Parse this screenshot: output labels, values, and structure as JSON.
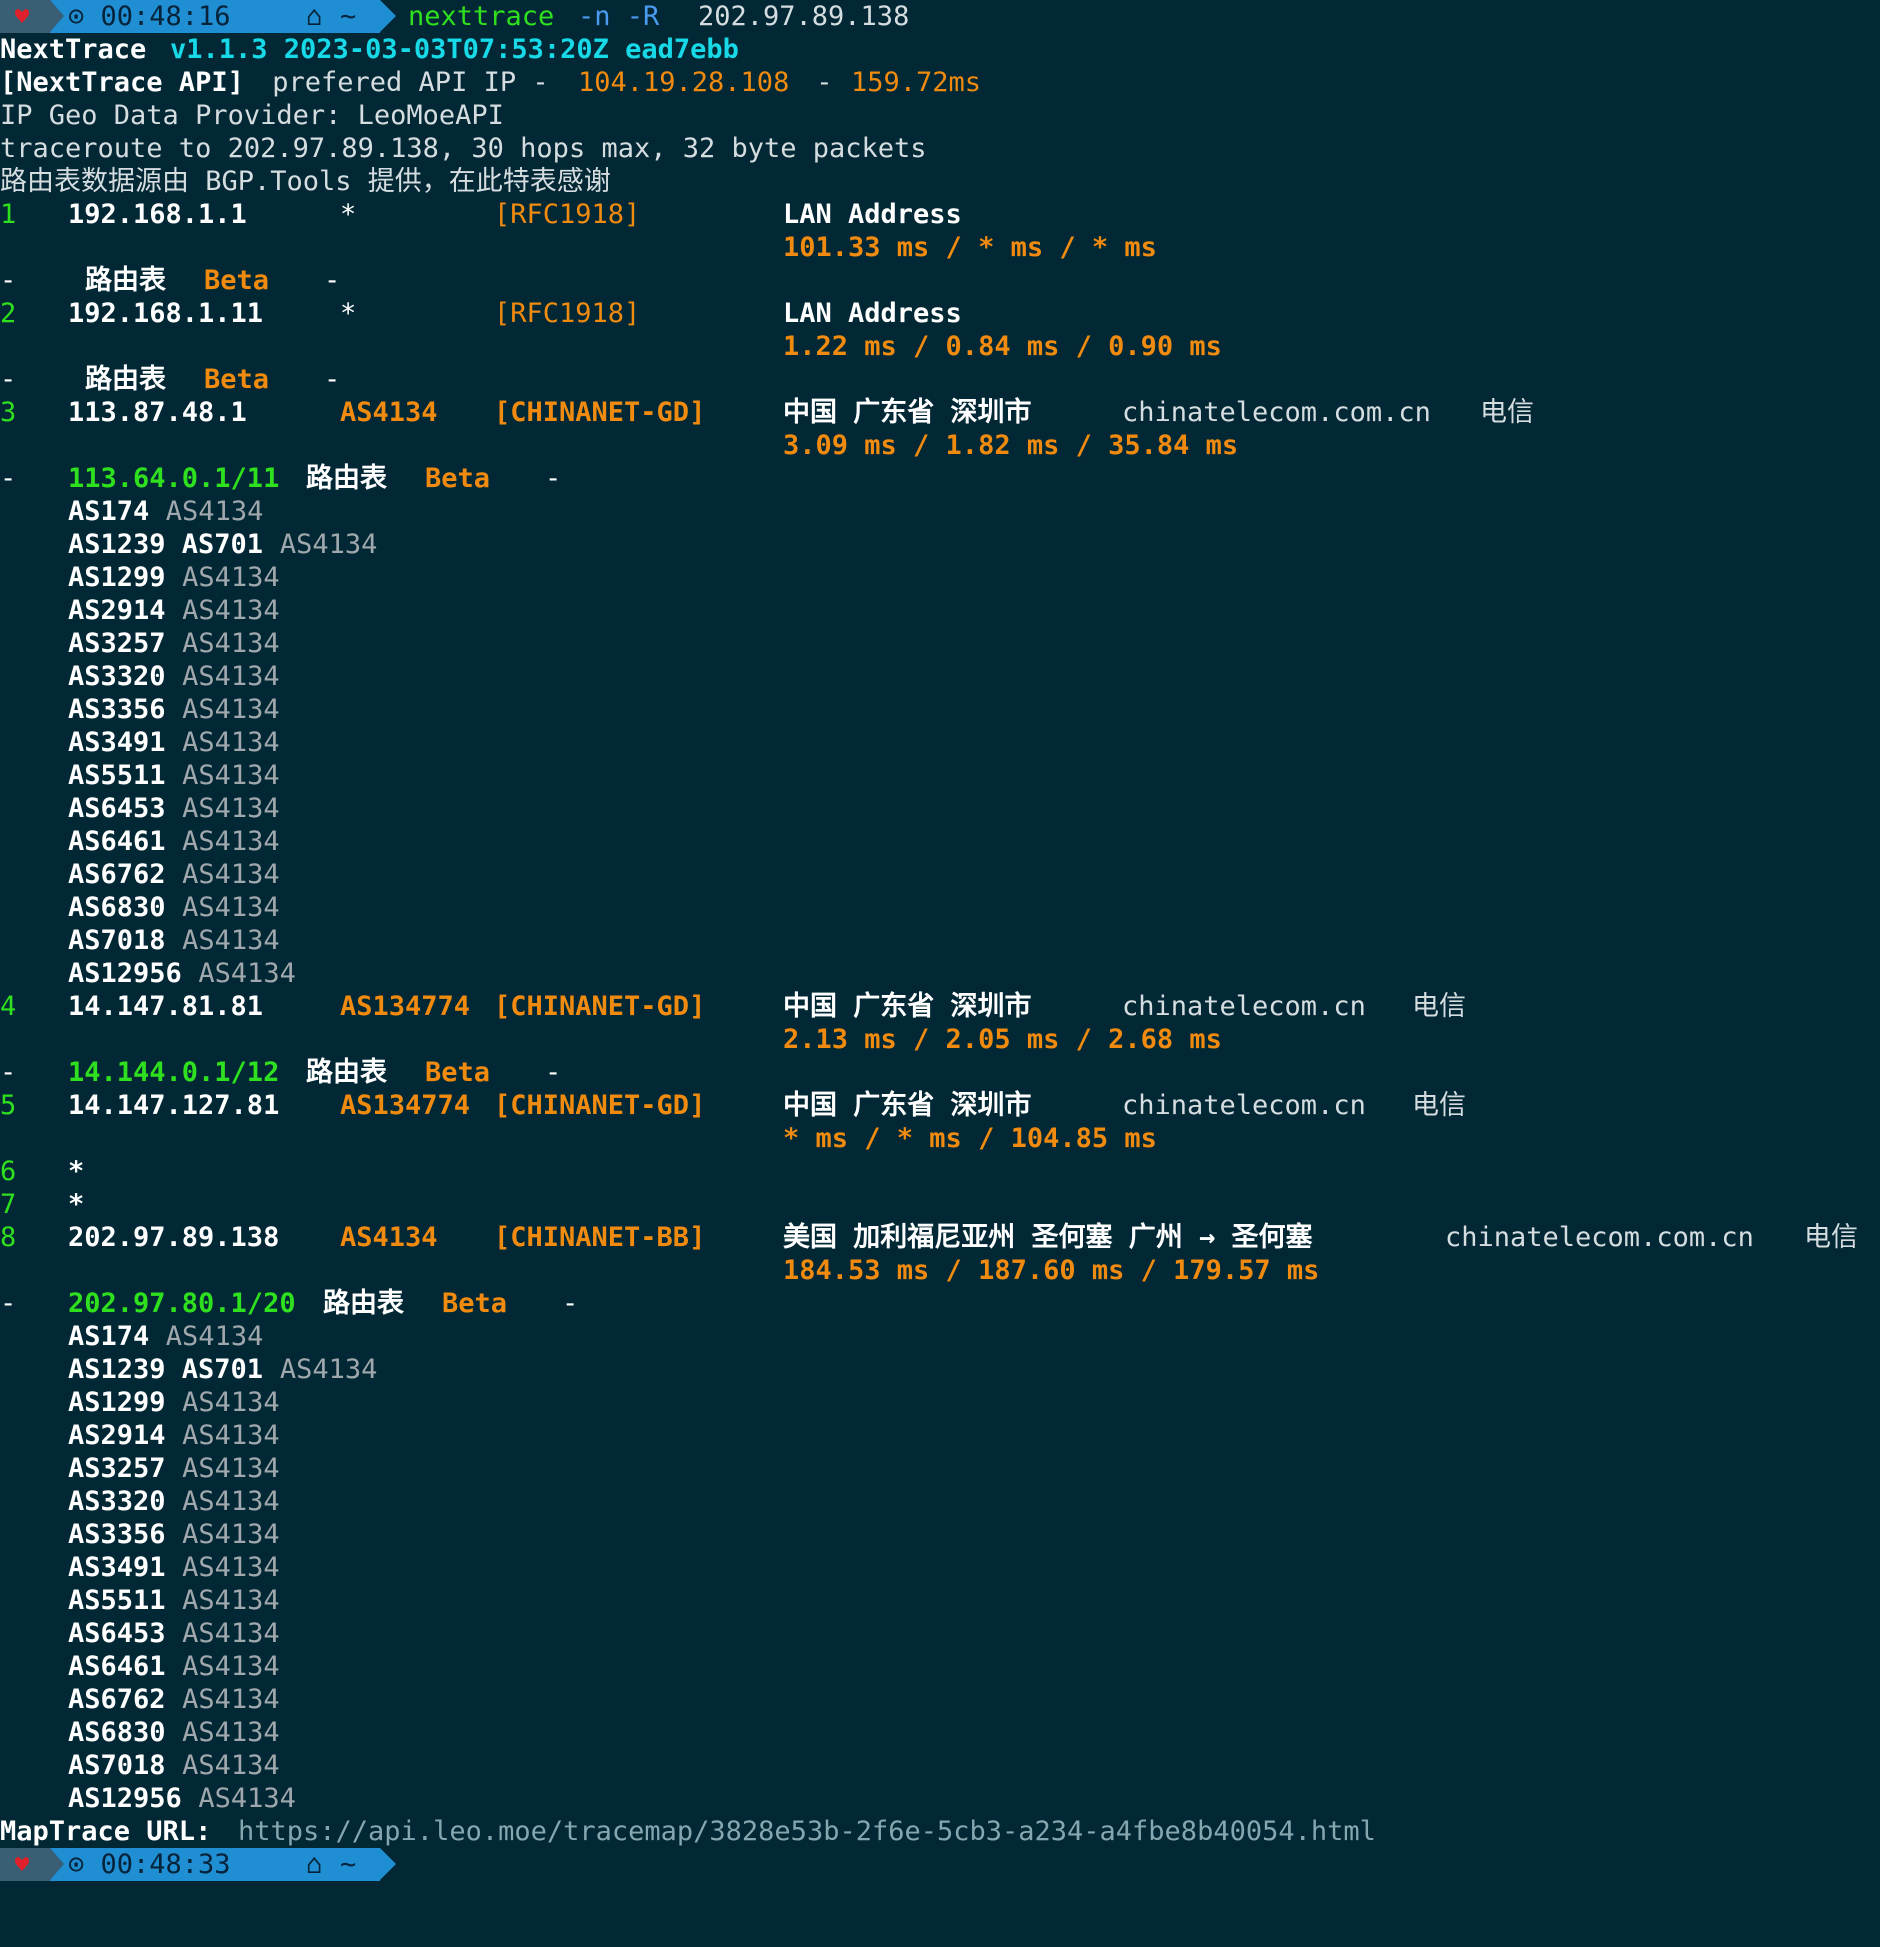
{
  "prompt_top": {
    "time": "⊙ 00:48:16",
    "home": "~",
    "cmd": "nexttrace",
    "flags": "-n -R",
    "target": "202.97.89.138"
  },
  "header": {
    "l1_a": "NextTrace ",
    "l1_b": "v1.1.3 2023-03-03T07:53:20Z ead7ebb",
    "l2_a": "[NextTrace API]",
    "l2_b": " prefered API IP - ",
    "l2_c": "104.19.28.108",
    "l2_d": " - ",
    "l2_e": "159.72ms",
    "l3": "IP Geo Data Provider: LeoMoeAPI",
    "l4": "traceroute to 202.97.89.138, 30 hops max, 32 byte packets",
    "l5": "路由表数据源由 BGP.Tools 提供，在此特表感谢"
  },
  "hops": {
    "h1": {
      "n": "1",
      "ip": "192.168.1.1",
      "as": "*",
      "tag": "[RFC1918]",
      "geo": "LAN Address",
      "rtt": "101.33 ms / * ms / * ms"
    },
    "r1": {
      "dash": "-",
      "label": "路由表",
      "beta": "Beta",
      "end": "-"
    },
    "h2": {
      "n": "2",
      "ip": "192.168.1.11",
      "as": "*",
      "tag": "[RFC1918]",
      "geo": "LAN Address",
      "rtt": "1.22 ms / 0.84 ms / 0.90 ms"
    },
    "r2": {
      "dash": "-",
      "label": "路由表",
      "beta": "Beta",
      "end": "-"
    },
    "h3": {
      "n": "3",
      "ip": "113.87.48.1",
      "as": "AS4134",
      "tag": "[CHINANET-GD]",
      "geo": "中国 广东省 深圳市",
      "domain": "chinatelecom.com.cn",
      "isp": "电信",
      "rtt": "3.09 ms / 1.82 ms / 35.84 ms"
    },
    "r3": {
      "dash": "-",
      "prefix": "113.64.0.1/11",
      "label": "路由表",
      "beta": "Beta",
      "end": "-"
    },
    "h4": {
      "n": "4",
      "ip": "14.147.81.81",
      "as": "AS134774",
      "tag": "[CHINANET-GD]",
      "geo": "中国 广东省 深圳市",
      "domain": "chinatelecom.cn",
      "isp": "电信",
      "rtt": "2.13 ms / 2.05 ms / 2.68 ms"
    },
    "r4": {
      "dash": "-",
      "prefix": "14.144.0.1/12",
      "label": "路由表",
      "beta": "Beta",
      "end": "-"
    },
    "h5": {
      "n": "5",
      "ip": "14.147.127.81",
      "as": "AS134774",
      "tag": "[CHINANET-GD]",
      "geo": "中国 广东省 深圳市",
      "domain": "chinatelecom.cn",
      "isp": "电信",
      "rtt": "* ms / * ms / 104.85 ms"
    },
    "h6": {
      "n": "6",
      "ip": "*"
    },
    "h7": {
      "n": "7",
      "ip": "*"
    },
    "h8": {
      "n": "8",
      "ip": "202.97.89.138",
      "as": "AS4134",
      "tag": "[CHINANET-BB]",
      "geo": "美国 加利福尼亚州 圣何塞 广州 → 圣何塞",
      "domain": "chinatelecom.com.cn",
      "isp": "电信",
      "rtt": "184.53 ms / 187.60 ms / 179.57 ms"
    },
    "r8": {
      "dash": "-",
      "prefix": "202.97.80.1/20",
      "label": "路由表",
      "beta": "Beta",
      "end": "-"
    }
  },
  "as_paths": [
    {
      "path": "AS174",
      "origin": "AS4134"
    },
    {
      "path": "AS1239 AS701",
      "origin": "AS4134"
    },
    {
      "path": "AS1299",
      "origin": "AS4134"
    },
    {
      "path": "AS2914",
      "origin": "AS4134"
    },
    {
      "path": "AS3257",
      "origin": "AS4134"
    },
    {
      "path": "AS3320",
      "origin": "AS4134"
    },
    {
      "path": "AS3356",
      "origin": "AS4134"
    },
    {
      "path": "AS3491",
      "origin": "AS4134"
    },
    {
      "path": "AS5511",
      "origin": "AS4134"
    },
    {
      "path": "AS6453",
      "origin": "AS4134"
    },
    {
      "path": "AS6461",
      "origin": "AS4134"
    },
    {
      "path": "AS6762",
      "origin": "AS4134"
    },
    {
      "path": "AS6830",
      "origin": "AS4134"
    },
    {
      "path": "AS7018",
      "origin": "AS4134"
    },
    {
      "path": "AS12956",
      "origin": "AS4134"
    }
  ],
  "footer": {
    "label": "MapTrace URL: ",
    "url": "https://api.leo.moe/tracemap/3828e53b-2f6e-5cb3-a234-a4fbe8b40054.html"
  },
  "prompt_bottom": {
    "time": "⊙ 00:48:33",
    "home": "~"
  },
  "colors": {
    "background": "#012834",
    "green": "#2fe01f",
    "orange": "#f18b10",
    "cyan": "#17d9e8",
    "blue_segment": "#1f8ed2"
  }
}
